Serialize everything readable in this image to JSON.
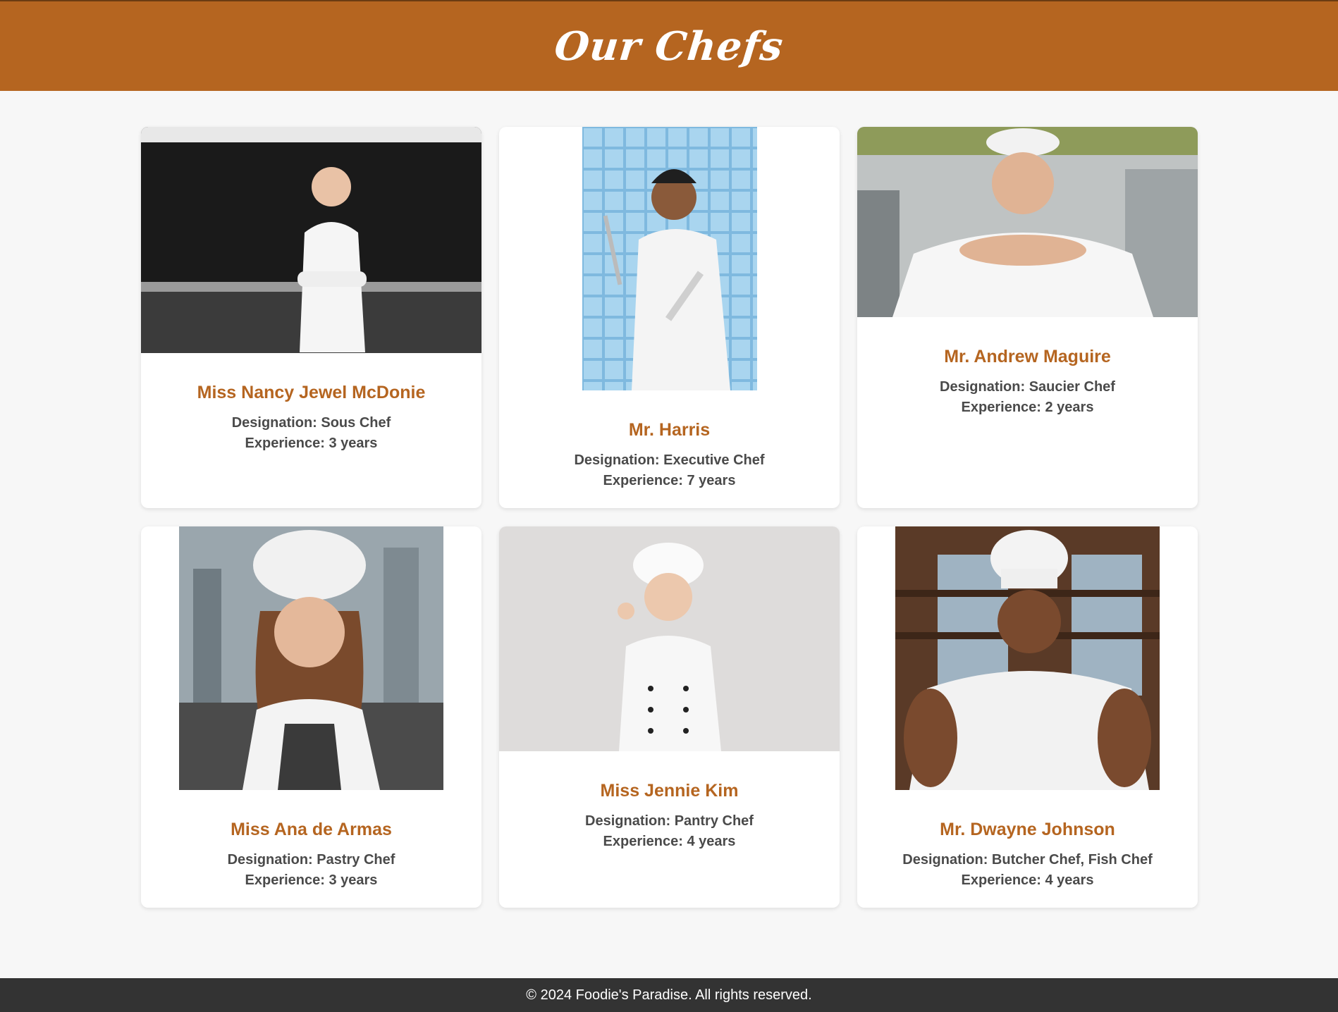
{
  "header": {
    "title": "Our Chefs"
  },
  "chefs": [
    {
      "name": "Miss Nancy Jewel McDonie",
      "designation": "Designation: Sous Chef",
      "experience": "Experience: 3 years",
      "photo_icon": "female-chef-photo"
    },
    {
      "name": "Mr. Harris",
      "designation": "Designation: Executive Chef",
      "experience": "Experience: 7 years",
      "photo_icon": "male-chef-knives-photo"
    },
    {
      "name": "Mr. Andrew Maguire",
      "designation": "Designation: Saucier Chef",
      "experience": "Experience: 2 years",
      "photo_icon": "male-chef-photo"
    },
    {
      "name": "Miss Ana de Armas",
      "designation": "Designation: Pastry Chef",
      "experience": "Experience: 3 years",
      "photo_icon": "female-chef-hat-photo"
    },
    {
      "name": "Miss Jennie Kim",
      "designation": "Designation: Pantry Chef",
      "experience": "Experience: 4 years",
      "photo_icon": "female-chef-hat-photo"
    },
    {
      "name": "Mr. Dwayne Johnson",
      "designation": "Designation: Butcher Chef, Fish Chef",
      "experience": "Experience: 4 years",
      "photo_icon": "male-chef-hat-photo"
    }
  ],
  "footer": {
    "text": "© 2024 Foodie's Paradise. All rights reserved."
  },
  "colors": {
    "accent": "#b56520",
    "footer_bg": "#333333",
    "page_bg": "#f7f7f7"
  }
}
